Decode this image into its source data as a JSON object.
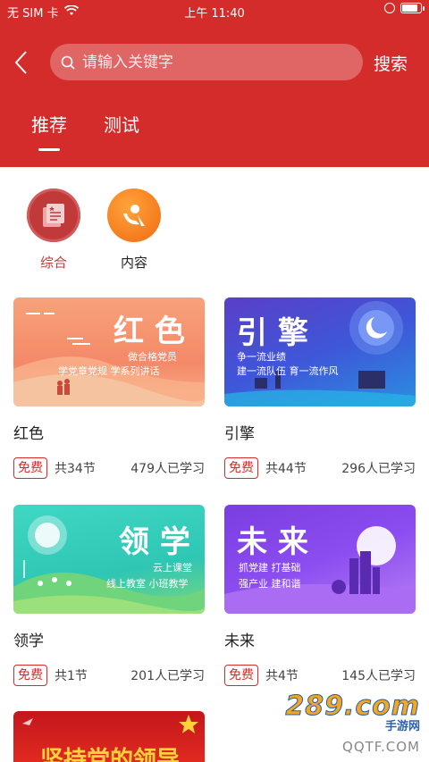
{
  "status_bar": {
    "carrier": "无 SIM 卡",
    "time": "上午 11:40"
  },
  "header": {
    "search_placeholder": "请输入关键字",
    "search_button": "搜索",
    "tabs": [
      {
        "label": "推荐",
        "active": true
      },
      {
        "label": "测试",
        "active": false
      }
    ]
  },
  "categories": [
    {
      "label": "综合",
      "active": true,
      "icon": "document-icon",
      "color": "#c03a3a"
    },
    {
      "label": "内容",
      "active": false,
      "icon": "orange-logo-icon",
      "color": "#f37a1f"
    }
  ],
  "courses": [
    {
      "title": "红色",
      "badge": "免费",
      "lessons": "共34节",
      "learners": "479人已学习",
      "banner": {
        "headline": "红 色",
        "line1": "做合格党员",
        "line2": "学党章党规  学系列讲话"
      }
    },
    {
      "title": "引擎",
      "badge": "免费",
      "lessons": "共44节",
      "learners": "296人已学习",
      "banner": {
        "headline": "引 擎",
        "line1": "争一流业绩",
        "line2": "建一流队伍  育一流作风"
      }
    },
    {
      "title": "领学",
      "badge": "免费",
      "lessons": "共1节",
      "learners": "201人已学习",
      "banner": {
        "headline": "领 学",
        "line1": "云上课堂",
        "line2": "线上教室  小班教学"
      }
    },
    {
      "title": "未来",
      "badge": "免费",
      "lessons": "共4节",
      "learners": "145人已学习",
      "banner": {
        "headline": "未 来",
        "line1": "抓党建  打基础",
        "line2": "强产业  建和谐"
      }
    }
  ],
  "partial_banner": {
    "headline": "坚持党的领导"
  },
  "watermark": {
    "logo": "289.com",
    "sub": "手游网",
    "site": "QQTF.COM"
  },
  "colors": {
    "brand_red": "#d42b2b",
    "category_active": "#c03a3a"
  }
}
